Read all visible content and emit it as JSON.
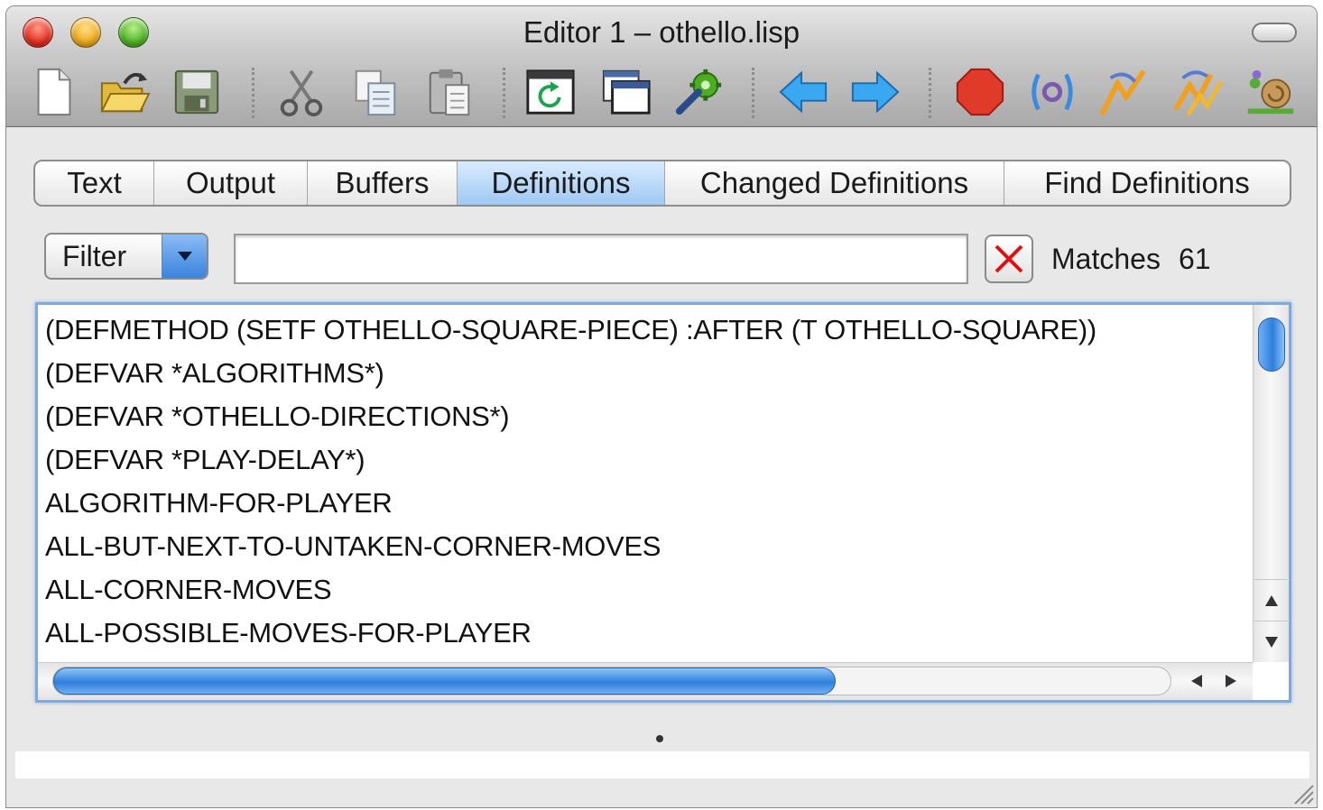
{
  "window": {
    "title": "Editor 1 – othello.lisp"
  },
  "toolbar": {
    "items": [
      {
        "name": "new-file-button",
        "icon": "new-file-icon"
      },
      {
        "name": "open-file-button",
        "icon": "open-folder-icon"
      },
      {
        "name": "save-button",
        "icon": "save-disk-icon"
      },
      {
        "name": "cut-button",
        "icon": "scissors-icon"
      },
      {
        "name": "copy-button",
        "icon": "copy-icon"
      },
      {
        "name": "paste-button",
        "icon": "paste-icon"
      },
      {
        "name": "refresh-button",
        "icon": "refresh-icon"
      },
      {
        "name": "windows-button",
        "icon": "windows-icon"
      },
      {
        "name": "tools-button",
        "icon": "gear-wrench-icon"
      },
      {
        "name": "back-button",
        "icon": "arrow-left-icon"
      },
      {
        "name": "forward-button",
        "icon": "arrow-right-icon"
      },
      {
        "name": "stop-button",
        "icon": "stop-icon"
      },
      {
        "name": "evaluate-button",
        "icon": "evaluate-icon"
      },
      {
        "name": "compile-button",
        "icon": "lightning-icon"
      },
      {
        "name": "compile-all-button",
        "icon": "lightning-double-icon"
      },
      {
        "name": "step-button",
        "icon": "snail-icon"
      }
    ]
  },
  "tabs": [
    {
      "label": "Text",
      "active": false
    },
    {
      "label": "Output",
      "active": false
    },
    {
      "label": "Buffers",
      "active": false
    },
    {
      "label": "Definitions",
      "active": true
    },
    {
      "label": "Changed Definitions",
      "active": false
    },
    {
      "label": "Find Definitions",
      "active": false
    }
  ],
  "filter": {
    "label": "Filter",
    "value": "",
    "matches_label": "Matches",
    "matches_count": "61"
  },
  "definitions": [
    "(DEFMETHOD (SETF OTHELLO-SQUARE-PIECE) :AFTER (T OTHELLO-SQUARE))",
    "(DEFVAR *ALGORITHMS*)",
    "(DEFVAR *OTHELLO-DIRECTIONS*)",
    "(DEFVAR *PLAY-DELAY*)",
    "ALGORITHM-FOR-PLAYER",
    "ALL-BUT-NEXT-TO-UNTAKEN-CORNER-MOVES",
    "ALL-CORNER-MOVES",
    "ALL-POSSIBLE-MOVES-FOR-PLAYER"
  ],
  "scroll": {
    "vertical_position": 0.0,
    "horizontal_fraction": 0.7
  },
  "colors": {
    "accent": "#3a83dd",
    "active_tab": "#9fc8f2",
    "clear_x": "#e01010"
  }
}
